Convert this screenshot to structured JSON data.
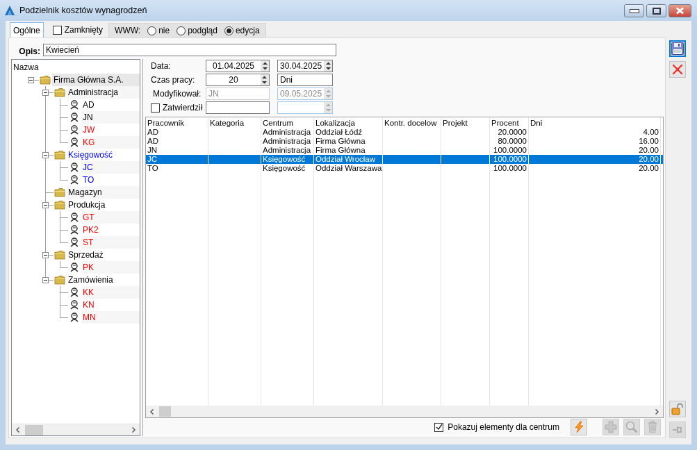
{
  "window": {
    "title": "Podzielnik kosztów wynagrodzeń"
  },
  "tabs": [
    {
      "label": "Ogólne",
      "selected": true
    }
  ],
  "closed_checkbox": {
    "label": "Zamknięty",
    "checked": false
  },
  "www": {
    "label": "WWW:",
    "options": [
      {
        "label": "nie",
        "selected": false
      },
      {
        "label": "podgląd",
        "selected": false
      },
      {
        "label": "edycja",
        "selected": true
      }
    ]
  },
  "description": {
    "label": "Opis:",
    "value": "Kwiecień"
  },
  "tree": {
    "header": "Nazwa",
    "items": [
      {
        "label": "Firma Główna S.A.",
        "kind": "folder",
        "color": "#000000",
        "selected": true,
        "expanded": true,
        "children": [
          {
            "label": "Administracja",
            "kind": "folder",
            "color": "#000000",
            "selected": false,
            "expanded": true,
            "children": [
              {
                "label": "AD",
                "kind": "person",
                "color": "#000000",
                "selected": false
              },
              {
                "label": "JN",
                "kind": "person",
                "color": "#000000",
                "selected": false
              },
              {
                "label": "JW",
                "kind": "person",
                "color": "#ff0000",
                "selected": false
              },
              {
                "label": "KG",
                "kind": "person",
                "color": "#ff0000",
                "selected": false
              }
            ]
          },
          {
            "label": "Księgowość",
            "kind": "folder",
            "color": "#0000ff",
            "selected": false,
            "expanded": true,
            "children": [
              {
                "label": "JC",
                "kind": "person",
                "color": "#0000ff",
                "selected": false
              },
              {
                "label": "TO",
                "kind": "person",
                "color": "#0000ff",
                "selected": false
              }
            ]
          },
          {
            "label": "Magazyn",
            "kind": "folder",
            "color": "#000000",
            "selected": false
          },
          {
            "label": "Produkcja",
            "kind": "folder",
            "color": "#000000",
            "selected": false,
            "expanded": true,
            "children": [
              {
                "label": "GT",
                "kind": "person",
                "color": "#ff0000",
                "selected": false
              },
              {
                "label": "PK2",
                "kind": "person",
                "color": "#ff0000",
                "selected": false
              },
              {
                "label": "ST",
                "kind": "person",
                "color": "#ff0000",
                "selected": false
              }
            ]
          },
          {
            "label": "Sprzedaż",
            "kind": "folder",
            "color": "#000000",
            "selected": false,
            "expanded": true,
            "children": [
              {
                "label": "PK",
                "kind": "person",
                "color": "#ff0000",
                "selected": false
              }
            ]
          },
          {
            "label": "Zamówienia",
            "kind": "folder",
            "color": "#000000",
            "selected": false,
            "expanded": true,
            "children": [
              {
                "label": "KK",
                "kind": "person",
                "color": "#ff0000",
                "selected": false
              },
              {
                "label": "KN",
                "kind": "person",
                "color": "#ff0000",
                "selected": false
              },
              {
                "label": "MN",
                "kind": "person",
                "color": "#ff0000",
                "selected": false
              }
            ]
          }
        ]
      }
    ]
  },
  "form": {
    "rows": [
      {
        "label": "Data:",
        "kind": "text",
        "fields": [
          {
            "value": "01.04.2025",
            "spinner": true,
            "disabled": false
          },
          {
            "value": "30.04.2025",
            "spinner": true,
            "disabled": false
          }
        ]
      },
      {
        "label": "Czas pracy:",
        "kind": "text",
        "fields": [
          {
            "value": "20",
            "spinner": true,
            "disabled": false
          },
          {
            "value": "Dni",
            "spinner": false,
            "disabled": false
          }
        ]
      },
      {
        "label": "Modyfikował:",
        "kind": "text",
        "fields": [
          {
            "value": "JN",
            "spinner": false,
            "disabled": true
          },
          {
            "value": "09.05.2025",
            "spinner": true,
            "disabled": true
          }
        ]
      },
      {
        "label": "Zatwierdził",
        "kind": "checkbox",
        "checked": false,
        "fields": [
          {
            "spinner": false,
            "disabled": false
          },
          {
            "spinner": true,
            "disabled": true
          }
        ]
      }
    ]
  },
  "table": {
    "columns": [
      "Pracownik",
      "Kategoria",
      "Centrum",
      "Lokalizacja",
      "Kontr. docelow",
      "Projekt",
      "Procent",
      "Dni"
    ],
    "rows": [
      {
        "employee": "AD",
        "center": "Administracja",
        "location": "Oddział Łódź",
        "percent": "20.0000",
        "days": "4.00",
        "selected": false
      },
      {
        "employee": "AD",
        "center": "Administracja",
        "location": "Firma Główna",
        "percent": "80.0000",
        "days": "16.00",
        "selected": false
      },
      {
        "employee": "JN",
        "center": "Administracja",
        "location": "Firma Główna",
        "percent": "100.0000",
        "days": "20.00",
        "selected": false
      },
      {
        "employee": "JC",
        "center": "Księgowość",
        "location": "Oddział Wrocław",
        "percent": "100.0000",
        "days": "20.00",
        "selected": true
      },
      {
        "employee": "TO",
        "center": "Księgowość",
        "location": "Oddział Warszawa",
        "percent": "100.0000",
        "days": "20.00",
        "selected": false
      }
    ]
  },
  "show_elements_checkbox": {
    "label": "Pokazuj elementy dla centrum",
    "checked": true
  },
  "grid_buttons": [
    {
      "kind": "lightning",
      "disabled": false
    },
    {
      "kind": "add",
      "disabled": true
    },
    {
      "kind": "search",
      "disabled": true
    },
    {
      "kind": "delete",
      "disabled": true
    }
  ],
  "side_buttons": [
    {
      "kind": "save",
      "disabled": false,
      "focused": true
    },
    {
      "kind": "cancel",
      "disabled": false,
      "focused": false
    }
  ],
  "side_bottom_buttons": [
    {
      "kind": "lock",
      "disabled": false,
      "focused": false
    },
    {
      "kind": "pin",
      "disabled": true,
      "focused": false
    }
  ]
}
